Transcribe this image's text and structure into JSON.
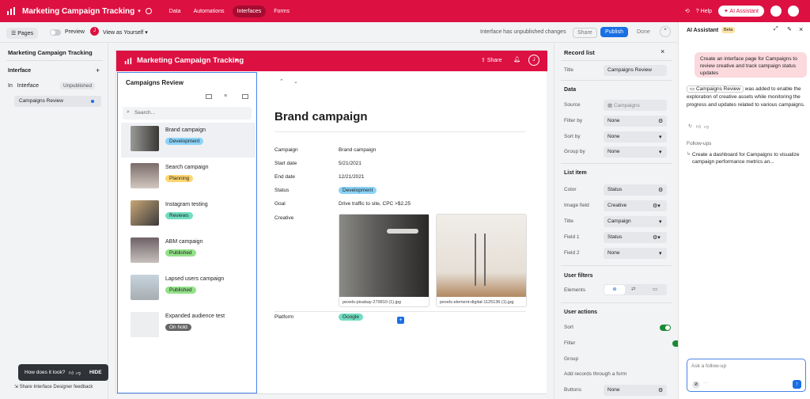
{
  "topbar": {
    "base_title": "Marketing Campaign Tracking",
    "nav": [
      "Data",
      "Automations",
      "Interfaces",
      "Forms"
    ],
    "active_nav": "Interfaces",
    "help": "Help",
    "ai_button": "AI Assistant"
  },
  "subbar": {
    "pages": "Pages",
    "preview": "Preview",
    "view_as": "View as Yourself",
    "avatar_letter": "J",
    "unpublished_msg": "Interface has unpublished changes",
    "share": "Share",
    "publish": "Publish",
    "done": "Done"
  },
  "leftpanel": {
    "title": "Marketing Campaign Tracking",
    "interface_header": "Interface",
    "interface_item": "Interface",
    "status": "Unpublished",
    "page_item": "Campaigns Review"
  },
  "interface": {
    "title": "Marketing Campaign Tracking",
    "share": "Share",
    "avatar_letter": "J",
    "list_title": "Campaigns Review",
    "search_placeholder": "Search...",
    "records": [
      {
        "name": "Brand campaign",
        "status": "Development",
        "color": "#8bd3f7"
      },
      {
        "name": "Search campaign",
        "status": "Planning",
        "color": "#ffd66e"
      },
      {
        "name": "Instagram testing",
        "status": "Reviews",
        "color": "#72ddc3"
      },
      {
        "name": "ABM campaign",
        "status": "Published",
        "color": "#93e088"
      },
      {
        "name": "Lapsed users campaign",
        "status": "Published",
        "color": "#93e088"
      },
      {
        "name": "Expanded audience test",
        "status": "On hold",
        "color": "#666666"
      }
    ]
  },
  "detail": {
    "heading": "Brand campaign",
    "fields": [
      {
        "label": "Campaign",
        "value": "Brand campaign"
      },
      {
        "label": "Start date",
        "value": "5/21/2021"
      },
      {
        "label": "End date",
        "value": "12/21/2021"
      },
      {
        "label": "Status",
        "value": "Development"
      },
      {
        "label": "Goal",
        "value": "Drive traffic to site, CPC >$2.25"
      },
      {
        "label": "Creative",
        "value": ""
      },
      {
        "label": "Platform",
        "value": "Google"
      }
    ],
    "images": [
      "pexels-pixabay-279810 (1).jpg",
      "pexels-element-digital-1125136 (1).jpg"
    ]
  },
  "recpanel": {
    "title": "Record list",
    "title_label": "Title",
    "title_value": "Campaigns Review",
    "data_header": "Data",
    "source_label": "Source",
    "source_value": "Campaigns",
    "filter_label": "Filter by",
    "filter_value": "None",
    "sort_label": "Sort by",
    "sort_value": "None",
    "group_label": "Group by",
    "group_value": "None",
    "listitem_header": "List item",
    "color_label": "Color",
    "color_value": "Status",
    "image_label": "Image field",
    "image_value": "Creative",
    "title2_label": "Title",
    "title2_value": "Campaign",
    "field1_label": "Field 1",
    "field1_value": "Status",
    "field2_label": "Field 2",
    "field2_value": "None",
    "userfilters_header": "User filters",
    "elements_label": "Elements",
    "useractions_header": "User actions",
    "sort_toggle": "Sort",
    "filter_toggle": "Filter",
    "group_toggle": "Group",
    "addrecords_toggle": "Add records through a form",
    "buttons_label": "Buttons",
    "buttons_value": "None"
  },
  "aipanel": {
    "title": "AI Assistant",
    "badge": "Beta",
    "user_msg": "Create an interface page for Campaigns to review creative and track campaign status updates",
    "chip": "Campaigns Review",
    "reply": "was added to enable the exploration of creative assets while monitoring the progress and updates related to various campaigns.",
    "followups_header": "Follow-ups",
    "followup_1": "Create a dashboard for Campaigns to visualize campaign performance metrics an...",
    "input_placeholder": "Ask a follow-up"
  },
  "toast": {
    "question": "How does it look?",
    "hide": "HIDE",
    "feedback": "Share Interface Designer feedback"
  }
}
